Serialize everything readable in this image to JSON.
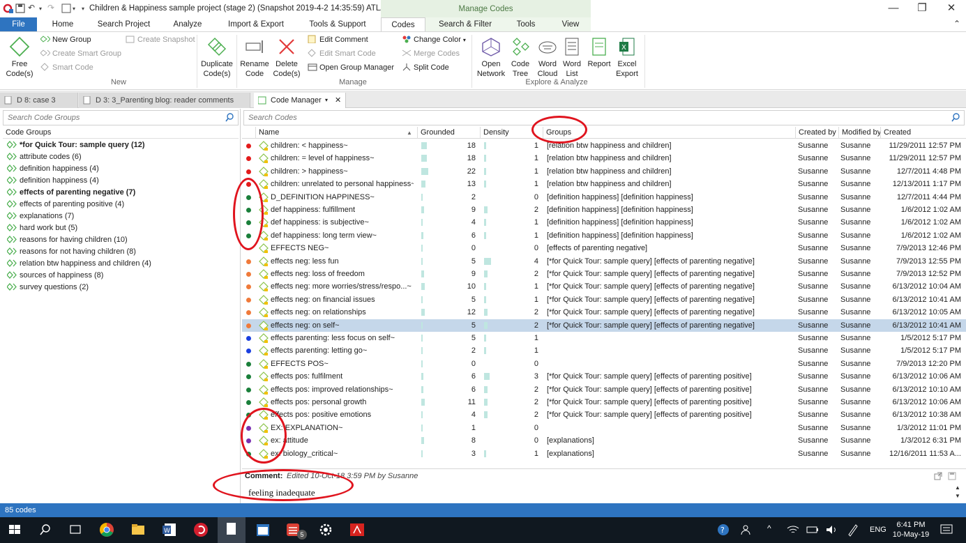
{
  "window": {
    "title": "Children & Happiness sample project (stage 2) (Snapshot 2019-4-2 14:35:59)  ATLAS.ti",
    "context_label": "Manage Codes",
    "minimize": "—",
    "maximize": "❐",
    "close": "✕"
  },
  "ribbon_tabs": [
    "File",
    "Home",
    "Search Project",
    "Analyze",
    "Import & Export",
    "Tools & Support",
    "Codes",
    "Search & Filter",
    "Tools",
    "View"
  ],
  "active_tab": "Codes",
  "ribbon": {
    "free_codes": "Free\nCode(s)",
    "new_group": "New Group",
    "create_smart_group": "Create Smart Group",
    "smart_code": "Smart Code",
    "create_snapshot": "Create Snapshot",
    "duplicate_codes": "Duplicate\nCode(s)",
    "group_new": "New",
    "rename_code": "Rename\nCode",
    "delete_codes": "Delete\nCode(s)",
    "edit_comment": "Edit Comment",
    "edit_smart_code": "Edit Smart Code",
    "open_group_manager": "Open Group Manager",
    "change_color": "Change Color",
    "merge_codes": "Merge Codes",
    "split_code": "Split Code",
    "group_manage": "Manage",
    "open_network": "Open\nNetwork",
    "code_tree": "Code\nTree",
    "word_cloud": "Word\nCloud",
    "word_list": "Word\nList",
    "report": "Report",
    "excel_export": "Excel\nExport",
    "group_explore": "Explore & Analyze"
  },
  "doc_tabs": [
    {
      "label": "D 8: case 3"
    },
    {
      "label": "D 3: 3_Parenting blog: reader comments"
    },
    {
      "label": "Code Manager"
    }
  ],
  "left_pane": {
    "search_placeholder": "Search Code Groups",
    "header": "Code Groups",
    "groups": [
      {
        "label": "*for Quick Tour: sample query (12)",
        "bold": true
      },
      {
        "label": "attribute codes (6)",
        "bold": false
      },
      {
        "label": "definition happiness (4)",
        "bold": false
      },
      {
        "label": "definition happiness (4)",
        "bold": false
      },
      {
        "label": "effects of parenting negative (7)",
        "bold": true
      },
      {
        "label": "effects of parenting positive (4)",
        "bold": false
      },
      {
        "label": "explanations (7)",
        "bold": false
      },
      {
        "label": "hard work but (5)",
        "bold": false
      },
      {
        "label": "reasons for having children (10)",
        "bold": false
      },
      {
        "label": "reasons for not having children (8)",
        "bold": false
      },
      {
        "label": "relation btw happiness and children (4)",
        "bold": false
      },
      {
        "label": "sources of happiness (8)",
        "bold": false
      },
      {
        "label": "survey questions (2)",
        "bold": false
      }
    ]
  },
  "main": {
    "search_placeholder": "Search Codes",
    "columns": {
      "name": "Name",
      "grounded": "Grounded",
      "density": "Density",
      "groups": "Groups",
      "created_by": "Created by",
      "modified_by": "Modified by",
      "created": "Created"
    },
    "rows": [
      {
        "color": "#e31b1b",
        "name": "children: < happiness~",
        "grounded": "18",
        "density": "1",
        "groups": "[relation btw happiness and children]",
        "created_by": "Susanne",
        "modified_by": "Susanne",
        "created": "11/29/2011 12:57 PM"
      },
      {
        "color": "#e31b1b",
        "name": "children: = level of happiness~",
        "grounded": "18",
        "density": "1",
        "groups": "[relation btw happiness and children]",
        "created_by": "Susanne",
        "modified_by": "Susanne",
        "created": "11/29/2011 12:57 PM"
      },
      {
        "color": "#e31b1b",
        "name": "children: > happiness~",
        "grounded": "22",
        "density": "1",
        "groups": "[relation btw happiness and children]",
        "created_by": "Susanne",
        "modified_by": "Susanne",
        "created": "12/7/2011 4:48 PM"
      },
      {
        "color": "#e31b1b",
        "name": "children: unrelated to personal happiness~",
        "grounded": "13",
        "density": "1",
        "groups": "[relation btw happiness and children]",
        "created_by": "Susanne",
        "modified_by": "Susanne",
        "created": "12/13/2011 1:17 PM"
      },
      {
        "color": "#1a7f3a",
        "name": "D_DEFINITION HAPPINESS~",
        "grounded": "2",
        "density": "0",
        "groups": "[definition happiness] [definition happiness]",
        "created_by": "Susanne",
        "modified_by": "Susanne",
        "created": "12/7/2011 4:44 PM"
      },
      {
        "color": "#1a7f3a",
        "name": "def happiness: fulfillment",
        "grounded": "9",
        "density": "2",
        "groups": "[definition happiness] [definition happiness]",
        "created_by": "Susanne",
        "modified_by": "Susanne",
        "created": "1/6/2012 1:02 AM"
      },
      {
        "color": "#1a7f3a",
        "name": "def happiness: is subjective~",
        "grounded": "4",
        "density": "1",
        "groups": "[definition happiness] [definition happiness]",
        "created_by": "Susanne",
        "modified_by": "Susanne",
        "created": "1/6/2012 1:02 AM"
      },
      {
        "color": "#1a7f3a",
        "name": "def happiness: long term view~",
        "grounded": "6",
        "density": "1",
        "groups": "[definition happiness] [definition happiness]",
        "created_by": "Susanne",
        "modified_by": "Susanne",
        "created": "1/6/2012 1:02 AM"
      },
      {
        "color": "",
        "name": "EFFECTS NEG~",
        "grounded": "0",
        "density": "0",
        "groups": "[effects of parenting negative]",
        "created_by": "Susanne",
        "modified_by": "Susanne",
        "created": "7/9/2013 12:46 PM"
      },
      {
        "color": "#f07a3a",
        "name": "effects neg: less fun",
        "grounded": "5",
        "density": "4",
        "groups": "[*for Quick Tour: sample query] [effects of parenting negative]",
        "created_by": "Susanne",
        "modified_by": "Susanne",
        "created": "7/9/2013 12:55 PM"
      },
      {
        "color": "#f07a3a",
        "name": "effects neg: loss of freedom",
        "grounded": "9",
        "density": "2",
        "groups": "[*for Quick Tour: sample query] [effects of parenting negative]",
        "created_by": "Susanne",
        "modified_by": "Susanne",
        "created": "7/9/2013 12:52 PM"
      },
      {
        "color": "#f07a3a",
        "name": "effects neg: more worries/stress/respo...~",
        "grounded": "10",
        "density": "1",
        "groups": "[*for Quick Tour: sample query] [effects of parenting negative]",
        "created_by": "Susanne",
        "modified_by": "Susanne",
        "created": "6/13/2012 10:04 AM"
      },
      {
        "color": "#f07a3a",
        "name": "effects neg: on financial issues",
        "grounded": "5",
        "density": "1",
        "groups": "[*for Quick Tour: sample query] [effects of parenting negative]",
        "created_by": "Susanne",
        "modified_by": "Susanne",
        "created": "6/13/2012 10:41 AM"
      },
      {
        "color": "#f07a3a",
        "name": "effects neg: on relationships",
        "grounded": "12",
        "density": "2",
        "groups": "[*for Quick Tour: sample query] [effects of parenting negative]",
        "created_by": "Susanne",
        "modified_by": "Susanne",
        "created": "6/13/2012 10:05 AM"
      },
      {
        "color": "#f07a3a",
        "name": "effects neg: on self~",
        "grounded": "5",
        "density": "2",
        "groups": "[*for Quick Tour: sample query] [effects of parenting negative]",
        "created_by": "Susanne",
        "modified_by": "Susanne",
        "created": "6/13/2012 10:41 AM",
        "selected": true
      },
      {
        "color": "#1a3fe0",
        "name": "effects parenting: less focus on self~",
        "grounded": "5",
        "density": "1",
        "groups": "",
        "created_by": "Susanne",
        "modified_by": "Susanne",
        "created": "1/5/2012 5:17 PM"
      },
      {
        "color": "#1a3fe0",
        "name": "effects parenting: letting go~",
        "grounded": "2",
        "density": "1",
        "groups": "",
        "created_by": "Susanne",
        "modified_by": "Susanne",
        "created": "1/5/2012 5:17 PM"
      },
      {
        "color": "#1a7f3a",
        "name": "EFFECTS POS~",
        "grounded": "0",
        "density": "0",
        "groups": "",
        "created_by": "Susanne",
        "modified_by": "Susanne",
        "created": "7/9/2013 12:20 PM"
      },
      {
        "color": "#1a7f3a",
        "name": "effects pos: fulfilment",
        "grounded": "6",
        "density": "3",
        "groups": "[*for Quick Tour: sample query] [effects of parenting positive]",
        "created_by": "Susanne",
        "modified_by": "Susanne",
        "created": "6/13/2012 10:06 AM"
      },
      {
        "color": "#1a7f3a",
        "name": "effects pos: improved relationships~",
        "grounded": "6",
        "density": "2",
        "groups": "[*for Quick Tour: sample query] [effects of parenting positive]",
        "created_by": "Susanne",
        "modified_by": "Susanne",
        "created": "6/13/2012 10:10 AM"
      },
      {
        "color": "#1a7f3a",
        "name": "effects pos: personal growth",
        "grounded": "11",
        "density": "2",
        "groups": "[*for Quick Tour: sample query] [effects of parenting positive]",
        "created_by": "Susanne",
        "modified_by": "Susanne",
        "created": "6/13/2012 10:06 AM"
      },
      {
        "color": "#1a7f3a",
        "name": "effects pos: positive emotions",
        "grounded": "4",
        "density": "2",
        "groups": "[*for Quick Tour: sample query] [effects of parenting positive]",
        "created_by": "Susanne",
        "modified_by": "Susanne",
        "created": "6/13/2012 10:38 AM"
      },
      {
        "color": "#7a2fb0",
        "name": "EX:  EXPLANATION~",
        "grounded": "1",
        "density": "0",
        "groups": "",
        "created_by": "Susanne",
        "modified_by": "Susanne",
        "created": "1/3/2012 11:01 PM"
      },
      {
        "color": "#7a2fb0",
        "name": "ex: attitude",
        "grounded": "8",
        "density": "0",
        "groups": "[explanations]",
        "created_by": "Susanne",
        "modified_by": "Susanne",
        "created": "1/3/2012 6:31 PM"
      },
      {
        "color": "#1a7f3a",
        "name": "ex: biology_critical~",
        "grounded": "3",
        "density": "1",
        "groups": "[explanations]",
        "created_by": "Susanne",
        "modified_by": "Susanne",
        "created": "12/16/2011 11:53 A..."
      }
    ]
  },
  "comment": {
    "label": "Comment:",
    "meta": "Edited 10-Oct-18 3:59 PM by Susanne",
    "text": "feeling inadequate"
  },
  "status": {
    "count": "85 codes"
  },
  "taskbar": {
    "lang": "ENG",
    "time": "6:41 PM",
    "date": "10-May-19",
    "badge": "5"
  }
}
